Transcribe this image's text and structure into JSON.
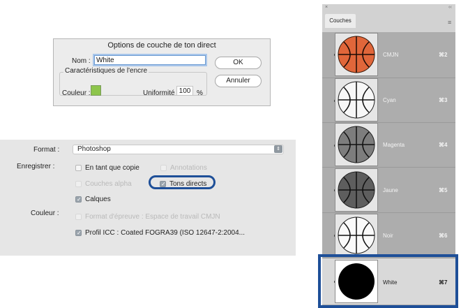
{
  "spot_dialog": {
    "title": "Options de couche de ton direct",
    "name_label": "Nom :",
    "name_value": "White",
    "ink_group_label": "Caractéristiques de l'encre",
    "color_label": "Couleur :",
    "color_swatch": "#8dc54b",
    "solidity_label": "Uniformité :",
    "solidity_value": "100",
    "percent": "%",
    "ok": "OK",
    "cancel": "Annuler"
  },
  "save_options": {
    "format_label": "Format :",
    "format_value": "Photoshop",
    "save_label": "Enregistrer :",
    "as_copy": "En tant que copie",
    "annotations": "Annotations",
    "alpha_channels": "Couches alpha",
    "spot_colors": "Tons directs",
    "layers": "Calques",
    "color_label": "Couleur :",
    "use_proof": "Format d'épreuve : Espace de travail CMJN",
    "icc_profile": "Profil ICC : Coated FOGRA39 (ISO 12647-2:2004..."
  },
  "channels_panel": {
    "tab": "Couches",
    "close": "×",
    "collapse": "‹‹",
    "menu": "≡",
    "channels": [
      {
        "name": "CMJN",
        "shortcut": "⌘2"
      },
      {
        "name": "Cyan",
        "shortcut": "⌘3"
      },
      {
        "name": "Magenta",
        "shortcut": "⌘4"
      },
      {
        "name": "Jaune",
        "shortcut": "⌘5"
      },
      {
        "name": "Noir",
        "shortcut": "⌘6"
      },
      {
        "name": "White",
        "shortcut": "⌘7"
      }
    ]
  },
  "colors": {
    "highlight": "#1e4f98",
    "basketball_orange": "#e0663a"
  }
}
